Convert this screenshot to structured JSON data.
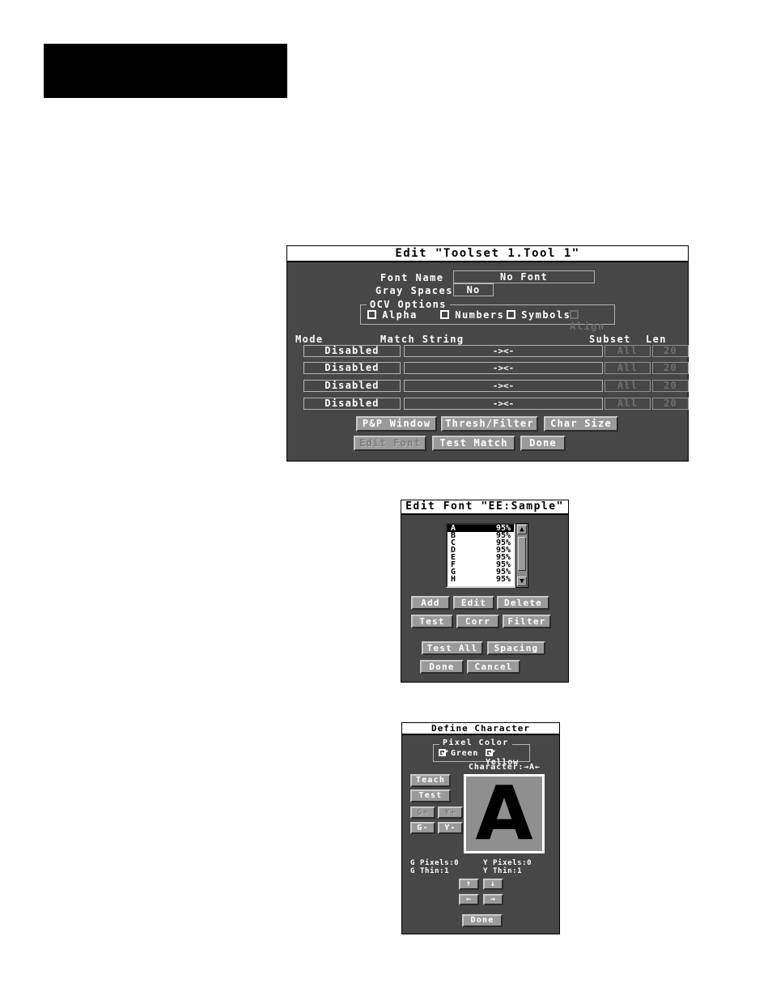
{
  "page": {
    "redacted_header": ""
  },
  "edit_tool_dialog": {
    "title": "Edit \"Toolset 1.Tool 1\"",
    "font_name_label": "Font Name",
    "font_name_value": "No Font",
    "gray_spaces_label": "Gray Spaces",
    "gray_spaces_value": "No",
    "ocv_group_label": "OCV Options",
    "ocv_options": [
      {
        "label": "Alpha",
        "checked": false,
        "enabled": true
      },
      {
        "label": "Numbers",
        "checked": false,
        "enabled": true
      },
      {
        "label": "Symbols",
        "checked": false,
        "enabled": true
      },
      {
        "label": "Align",
        "checked": false,
        "enabled": false
      }
    ],
    "columns": {
      "mode": "Mode",
      "match_string": "Match String",
      "subset": "Subset",
      "len": "Len"
    },
    "rows": [
      {
        "mode": "Disabled",
        "match_string": "-><-",
        "subset": "All",
        "len": "20"
      },
      {
        "mode": "Disabled",
        "match_string": "-><-",
        "subset": "All",
        "len": "20"
      },
      {
        "mode": "Disabled",
        "match_string": "-><-",
        "subset": "All",
        "len": "20"
      },
      {
        "mode": "Disabled",
        "match_string": "-><-",
        "subset": "All",
        "len": "20"
      }
    ],
    "buttons_row1": [
      {
        "label": "P&P Window",
        "enabled": true
      },
      {
        "label": "Thresh/Filter",
        "enabled": true
      },
      {
        "label": "Char Size",
        "enabled": true
      }
    ],
    "buttons_row2": [
      {
        "label": "Edit Font",
        "enabled": false
      },
      {
        "label": "Test Match",
        "enabled": true
      },
      {
        "label": "Done",
        "enabled": true
      }
    ]
  },
  "edit_font_dialog": {
    "title": "Edit Font \"EE:Sample\"",
    "list": [
      {
        "char": "A",
        "percent": "95%",
        "selected": true
      },
      {
        "char": "B",
        "percent": "95%",
        "selected": false
      },
      {
        "char": "C",
        "percent": "95%",
        "selected": false
      },
      {
        "char": "D",
        "percent": "95%",
        "selected": false
      },
      {
        "char": "E",
        "percent": "95%",
        "selected": false
      },
      {
        "char": "F",
        "percent": "95%",
        "selected": false
      },
      {
        "char": "G",
        "percent": "95%",
        "selected": false
      },
      {
        "char": "H",
        "percent": "95%",
        "selected": false
      }
    ],
    "scroll_up_icon": "arrow-up-icon",
    "scroll_down_icon": "arrow-down-icon",
    "buttons_row1": [
      {
        "label": "Add",
        "enabled": true
      },
      {
        "label": "Edit",
        "enabled": true
      },
      {
        "label": "Delete",
        "enabled": true
      }
    ],
    "buttons_row2": [
      {
        "label": "Test",
        "enabled": true
      },
      {
        "label": "Corr",
        "enabled": true
      },
      {
        "label": "Filter",
        "enabled": true
      }
    ],
    "buttons_row3": [
      {
        "label": "Test All",
        "enabled": true
      },
      {
        "label": "Spacing",
        "enabled": true
      }
    ],
    "buttons_row4": [
      {
        "label": "Done",
        "enabled": true
      },
      {
        "label": "Cancel",
        "enabled": true
      }
    ]
  },
  "define_char_dialog": {
    "title": "Define Character",
    "pixel_color_group_label": "Pixel Color",
    "pixel_colors": [
      {
        "label": "Green",
        "checked": true
      },
      {
        "label": "Yellow",
        "checked": true
      }
    ],
    "character_label": "Character:→A←",
    "character_glyph": "A",
    "left_buttons": [
      {
        "label": "Teach",
        "enabled": true
      },
      {
        "label": "Test",
        "enabled": true
      },
      {
        "label": "G+",
        "enabled": false
      },
      {
        "label": "Y+",
        "enabled": false
      },
      {
        "label": "G-",
        "enabled": true
      },
      {
        "label": "Y-",
        "enabled": true
      }
    ],
    "stats": {
      "g_pixels": "G Pixels:0",
      "g_thin": "G Thin:1",
      "y_pixels": "Y Pixels:0",
      "y_thin": "Y Thin:1"
    },
    "nudge_buttons": [
      {
        "label": "↑",
        "name": "nudge-up-button"
      },
      {
        "label": "↓",
        "name": "nudge-down-button"
      },
      {
        "label": "←",
        "name": "nudge-left-button"
      },
      {
        "label": "→",
        "name": "nudge-right-button"
      }
    ],
    "done_label": "Done"
  },
  "colors": {
    "dialog_bg": "#474747",
    "button_face": "#9a9a9a",
    "title_bg": "#ffffff",
    "text": "#ffffff",
    "disabled_text": "#7d7d7d"
  }
}
